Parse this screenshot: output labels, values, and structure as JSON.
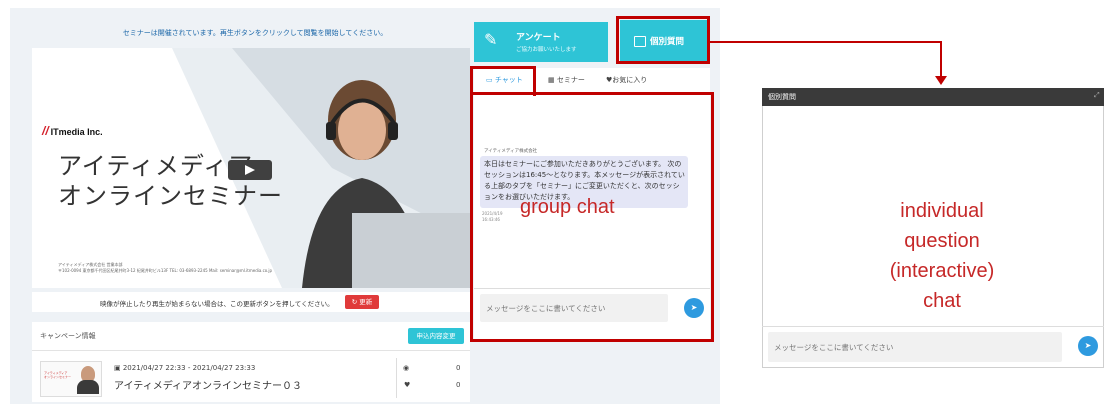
{
  "notice": "セミナーは開催されています。再生ボタンをクリックして閲覧を開始してください。",
  "video": {
    "logo_mark": "//",
    "logo_text": "ITmedia Inc.",
    "title_line1": "アイティメディア",
    "title_line2": "オンラインセミナー",
    "address": "アイティメディア株式会社 営業本部\n〒102-0094 東京都千代田区紀尾井町3-12 紀尾井町ビル13F TEL: 03-6893-2245 Mail: seminar@ml.itmedia.co.jp"
  },
  "reload": {
    "text": "映像が停止したり再生が始まらない場合は、この更新ボタンを押してください。",
    "button": "↻ 更新"
  },
  "campaign": {
    "title": "キャンペーン情報",
    "change_button": "申込内容変更",
    "item": {
      "thumb_text": "アイティメディア\nオンラインセミナー",
      "date": "2021/04/27 22:33 - 2021/04/27 23:33",
      "name": "アイティメディアオンラインセミナー０３",
      "views": "0",
      "likes": "0"
    }
  },
  "survey": {
    "title": "アンケート",
    "subtitle": "ご協力お願いいたします"
  },
  "individual_button": "個別質問",
  "tabs": {
    "chat": "チャット",
    "seminar": "セミナー",
    "favorites": "お気に入り"
  },
  "chat": {
    "sender": "アイティメディア株式会社",
    "message": "本日はセミナーにご参加いただきありがとうございます。 次のセッションは16:45～となります。本メッセージが表示されている上部のタブを「セミナー」にご変更いただくと、次のセッションをお選びいただけます。",
    "timestamp": "2021/4/19\n16:43:46",
    "input_placeholder": "メッセージをここに書いてください"
  },
  "annotations": {
    "group_chat": "group chat",
    "individual_chat": "individual\nquestion\n(interactive)\nchat"
  },
  "individual_window": {
    "title": "個別質問",
    "input_placeholder": "メッセージをここに書いてください"
  },
  "colors": {
    "accent": "#2ec4d6",
    "highlight": "#c00000",
    "send": "#2e9adf"
  }
}
